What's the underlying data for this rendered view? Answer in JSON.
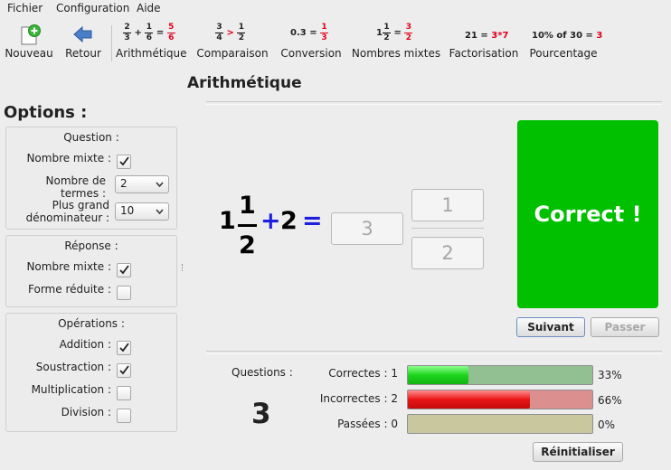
{
  "menu": {
    "items": [
      "Fichier",
      "Configuration",
      "Aide"
    ]
  },
  "toolbar": {
    "nouveau": "Nouveau",
    "retour": "Retour",
    "arith_label": "Arithmétique",
    "comp_label": "Comparaison",
    "conv_label": "Conversion",
    "mixed_label": "Nombres mixtes",
    "fact_label": "Factorisation",
    "pct_label": "Pourcentage",
    "conv_icon_left": "0.3 =",
    "fact_icon_left": "21 =",
    "fact_icon_right": "3*7",
    "pct_icon_left": "10% of 30 =",
    "pct_icon_right": "3"
  },
  "page_title": "Arithmétique",
  "options": {
    "title": "Options :",
    "question": {
      "title": "Question :",
      "mixed_label": "Nombre mixte :",
      "mixed_checked": true,
      "terms_label": "Nombre de termes :",
      "terms_value": "2",
      "denom_label_1": "Plus grand",
      "denom_label_2": "dénominateur :",
      "denom_value": "10"
    },
    "reponse": {
      "title": "Réponse :",
      "mixed_label": "Nombre mixte :",
      "mixed_checked": true,
      "reduced_label": "Forme réduite :",
      "reduced_checked": false
    },
    "operations": {
      "title": "Opérations :",
      "addition_label": "Addition :",
      "addition_checked": true,
      "subtraction_label": "Soustraction :",
      "subtraction_checked": true,
      "multiplication_label": "Multiplication :",
      "multiplication_checked": false,
      "division_label": "Division :",
      "division_checked": false
    }
  },
  "task": {
    "whole": "1",
    "numerator": "1",
    "denominator": "2",
    "operator": "+",
    "term2": "2",
    "equals": "=",
    "answer_whole": "3",
    "answer_numerator": "1",
    "answer_denominator": "2"
  },
  "result": {
    "text": "Correct !",
    "color": "#00c000"
  },
  "buttons": {
    "suivant": "Suivant",
    "passer": "Passer",
    "reset": "Réinitialiser"
  },
  "stats": {
    "questions_label": "Questions :",
    "questions_count": "3",
    "correct_label": "Correctes : 1",
    "correct_pct": "33%",
    "correct_fraction": 0.33,
    "incorrect_label": "Incorrectes : 2",
    "incorrect_pct": "66%",
    "incorrect_fraction": 0.66,
    "skipped_label": "Passées : 0",
    "skipped_pct": "0%",
    "skipped_fraction": 0
  }
}
